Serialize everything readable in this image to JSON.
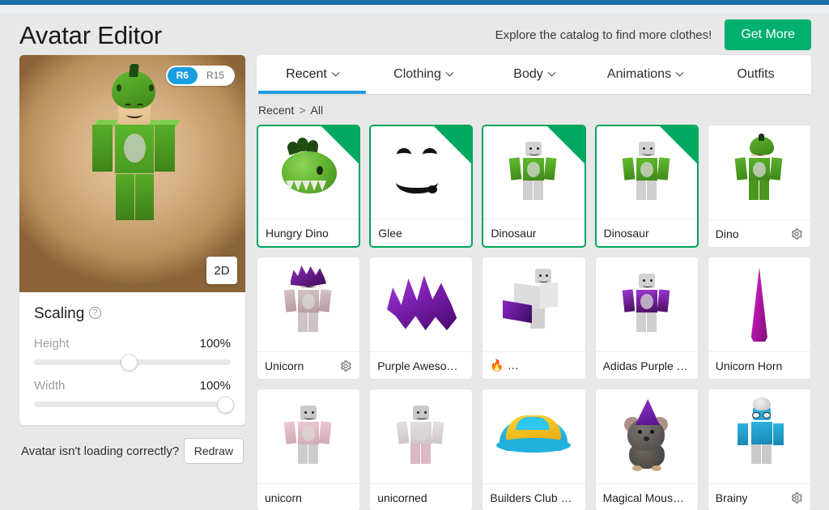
{
  "header": {
    "title": "Avatar Editor",
    "promo_text": "Explore the catalog to find more clothes!",
    "get_more_label": "Get More",
    "accent_green": "#00b06f",
    "accent_blue": "#1f9ce0"
  },
  "avatar_panel": {
    "rig_options": [
      {
        "label": "R6",
        "selected": true
      },
      {
        "label": "R15",
        "selected": false
      }
    ],
    "view_toggle_label": "2D"
  },
  "scaling": {
    "title": "Scaling",
    "help_icon": "question-mark-circle-icon",
    "sliders": [
      {
        "name": "Height",
        "value": "100%",
        "thumb_percent": 48
      },
      {
        "name": "Width",
        "value": "100%",
        "thumb_percent": 97
      }
    ]
  },
  "redraw": {
    "text": "Avatar isn't loading correctly?",
    "button_label": "Redraw"
  },
  "tabs": [
    {
      "label": "Recent",
      "has_caret": true,
      "active": true
    },
    {
      "label": "Clothing",
      "has_caret": true,
      "active": false
    },
    {
      "label": "Body",
      "has_caret": true,
      "active": false
    },
    {
      "label": "Animations",
      "has_caret": true,
      "active": false
    },
    {
      "label": "Outfits",
      "has_caret": false,
      "active": false
    }
  ],
  "breadcrumb": [
    "Recent",
    "All"
  ],
  "breadcrumb_separator": ">",
  "items": [
    {
      "label": "Hungry Dino",
      "equipped": true,
      "gear": false,
      "thumb": "dino-hat"
    },
    {
      "label": "Glee",
      "equipped": true,
      "gear": false,
      "thumb": "glee-face"
    },
    {
      "label": "Dinosaur",
      "equipped": true,
      "gear": false,
      "thumb": "green-shirt-figure"
    },
    {
      "label": "Dinosaur",
      "equipped": true,
      "gear": false,
      "thumb": "green-shirt-figure"
    },
    {
      "label": "Dino",
      "equipped": false,
      "gear": true,
      "thumb": "green-dino-avatar"
    },
    {
      "label": "Unicorn",
      "equipped": false,
      "gear": true,
      "thumb": "purple-hair-figure"
    },
    {
      "label": "Purple Aweso…",
      "equipped": false,
      "gear": false,
      "thumb": "purple-hair"
    },
    {
      "label": "🔥 …",
      "equipped": false,
      "gear": false,
      "thumb": "galaxy-shirt-side"
    },
    {
      "label": "Adidas Purple …",
      "equipped": false,
      "gear": false,
      "thumb": "galaxy-shirt-figure"
    },
    {
      "label": "Unicorn Horn",
      "equipped": false,
      "gear": false,
      "thumb": "magenta-horn"
    },
    {
      "label": "unicorn",
      "equipped": false,
      "gear": false,
      "thumb": "pink-shirt-figure"
    },
    {
      "label": "unicorned",
      "equipped": false,
      "gear": false,
      "thumb": "pink-shirt-figure-b"
    },
    {
      "label": "Builders Club …",
      "equipped": false,
      "gear": false,
      "thumb": "builders-club-hat"
    },
    {
      "label": "Magical Mous…",
      "equipped": false,
      "gear": false,
      "thumb": "magical-mouse"
    },
    {
      "label": "Brainy",
      "equipped": false,
      "gear": true,
      "thumb": "brainy-figure"
    }
  ],
  "icons": {
    "gear": "gear-icon",
    "caret_down": "chevron-down-icon"
  }
}
